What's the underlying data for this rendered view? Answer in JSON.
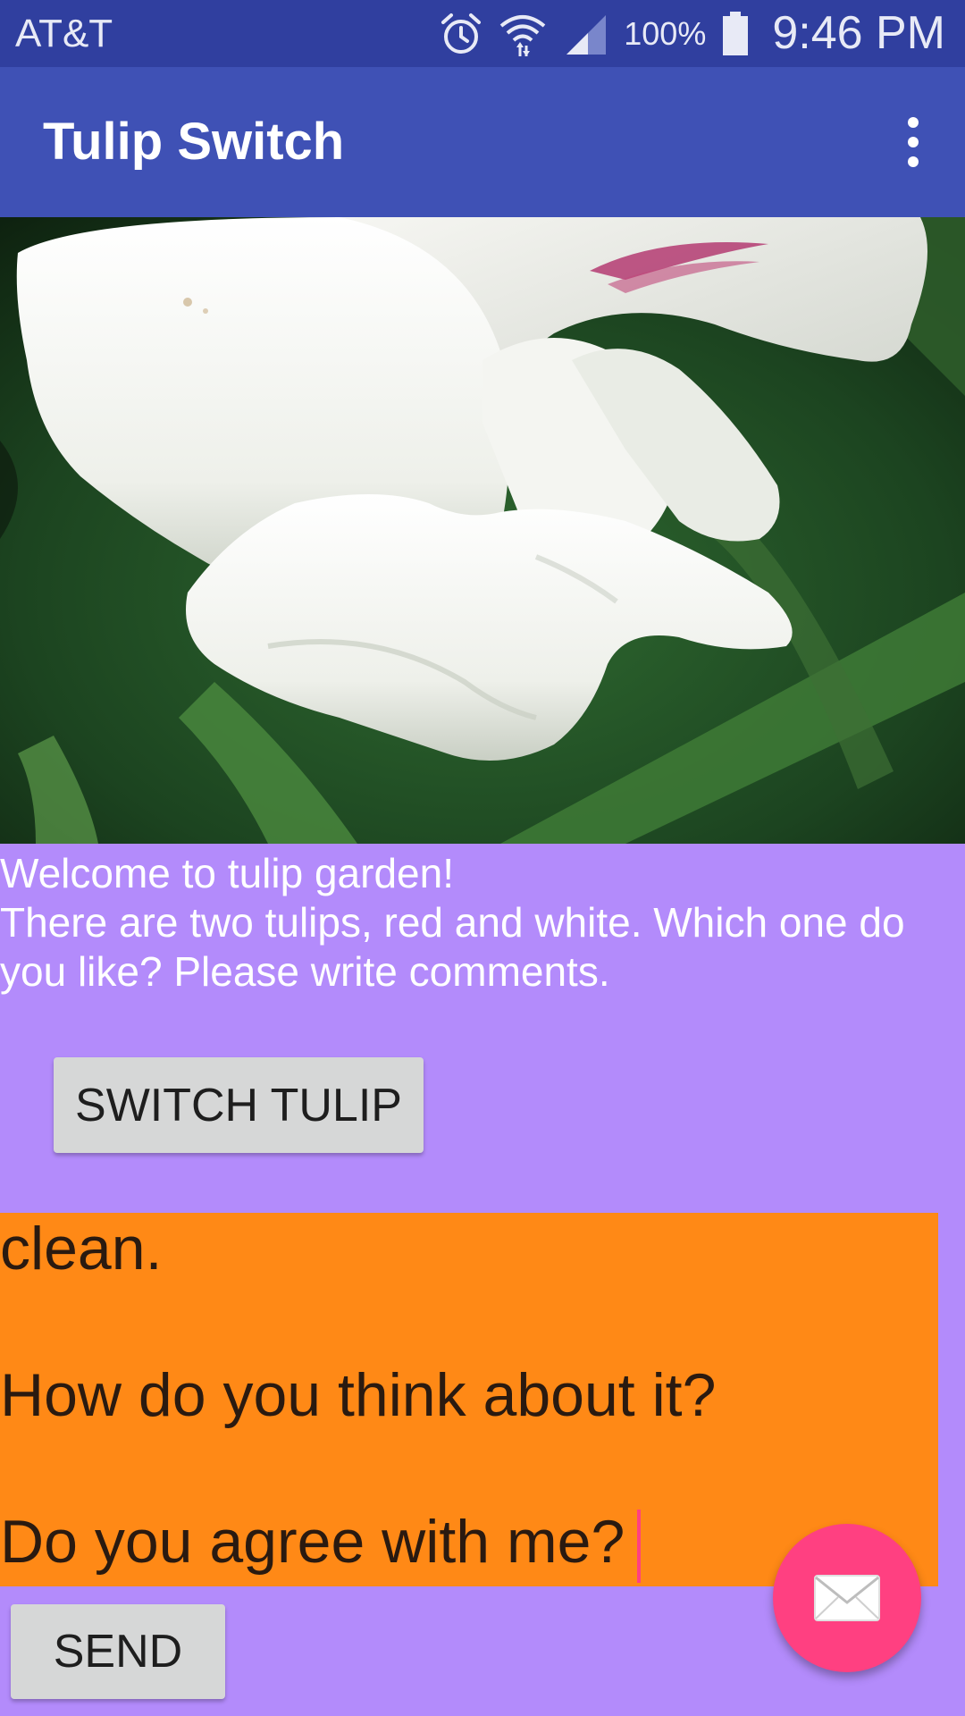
{
  "status_bar": {
    "carrier": "AT&T",
    "battery_percent": "100%",
    "time": "9:46 PM",
    "icons": [
      "alarm-icon",
      "wifi-icon",
      "cell-signal-icon",
      "battery-icon"
    ]
  },
  "app_bar": {
    "title": "Tulip Switch",
    "overflow_icon": "more-vert-icon"
  },
  "photo": {
    "subject": "white-tulip-photo"
  },
  "intro": {
    "line1": "Welcome to tulip garden!",
    "line2": "There are two tulips, red and white. Which one do",
    "line3": "you like? Please write comments."
  },
  "switch_button": {
    "label": "SWITCH TULIP"
  },
  "comment_field": {
    "lines": [
      "clean.",
      "",
      "How do you think about it?",
      "",
      "Do you agree with me?"
    ]
  },
  "send_button": {
    "label": "SEND"
  },
  "fab": {
    "icon": "email-icon"
  },
  "colors": {
    "status_bar": "#303f9f",
    "app_bar": "#3f51b5",
    "background": "#b38bfb",
    "comment_field": "#ff8916",
    "accent": "#ff4081",
    "button": "#d6d7d7"
  }
}
